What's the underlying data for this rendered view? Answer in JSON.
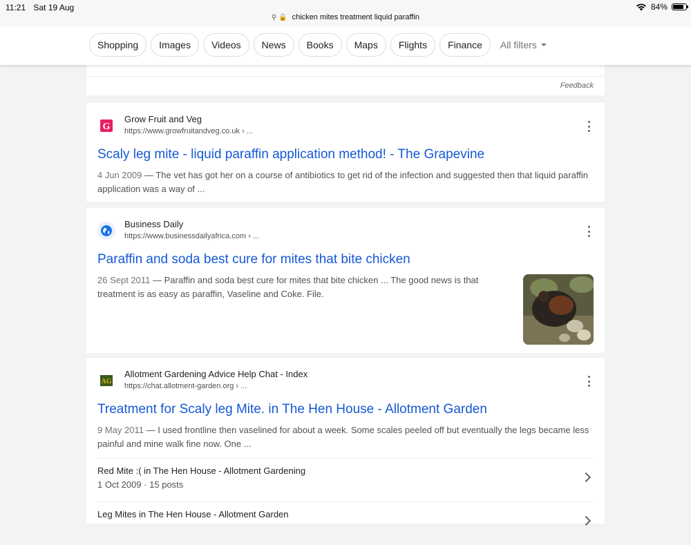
{
  "status_bar": {
    "time": "11:21",
    "date": "Sat 19 Aug",
    "battery_percent": "84%",
    "battery_level": 0.84
  },
  "url_bar": {
    "icons": "⚲ 🔒",
    "query": "chicken mites treatment liquid paraffin"
  },
  "filters": {
    "chips": [
      "Shopping",
      "Images",
      "Videos",
      "News",
      "Books",
      "Maps",
      "Flights",
      "Finance"
    ],
    "all_filters_label": "All filters"
  },
  "feedback": {
    "label": "Feedback"
  },
  "results": [
    {
      "site_name": "Grow Fruit and Veg",
      "site_url": "https://www.growfruitandveg.co.uk › ...",
      "favicon": "G",
      "favicon_color": "#e91e63",
      "title": "Scaly leg mite - liquid paraffin application method! - The Grapevine",
      "date": "4 Jun 2009",
      "snippet": "The vet has got her on a course of antibiotics to get rid of the infection and suggested then that liquid paraffin application was a way of ..."
    },
    {
      "site_name": "Business Daily",
      "site_url": "https://www.businessdailyafrica.com › ...",
      "favicon": "globe-icon",
      "favicon_color": "#1a73e8",
      "title": "Paraffin and soda best cure for mites that bite chicken",
      "date": "26 Sept 2011",
      "snippet": "Paraffin and soda best cure for mites that bite chicken ... The good news is that treatment is as easy as paraffin, Vaseline and Coke. File."
    },
    {
      "site_name": "Allotment Gardening Advice Help Chat - Index",
      "site_url": "https://chat.allotment-garden.org › ...",
      "favicon": "AG",
      "favicon_color": "#3a5a1a",
      "title": "Treatment for Scaly leg Mite. in The Hen House - Allotment Garden",
      "date": "9 May 2011",
      "snippet": "I used frontline then vaselined for about a week. Some scales peeled off but eventually the legs became less painful and mine walk fine now. One ...",
      "sub_links": [
        {
          "title": "Red Mite :( in The Hen House - Allotment Gardening",
          "meta": "1 Oct 2009 · 15 posts"
        },
        {
          "title": "Leg Mites in The Hen House - Allotment Garden",
          "meta": ""
        }
      ]
    }
  ],
  "colors": {
    "link_blue": "#1558d6",
    "background": "#f1f3f4"
  }
}
